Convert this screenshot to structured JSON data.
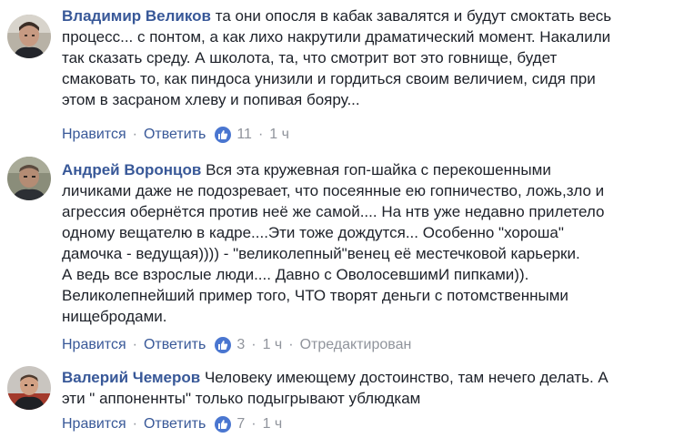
{
  "actions": {
    "like": "Нравится",
    "reply": "Ответить",
    "dot": "·"
  },
  "comments": [
    {
      "author": "Владимир Великов",
      "lines": [
        "та они опосля в кабак завалятся и будут смоктать весь",
        "процесс... с понтом, а как лихо накрутили драматический момент. Накалили",
        "так сказать среду. А школота, та, что смотрит вот это говнище, будет",
        "смаковать то, как пиндоса унизили и гордиться своим величием, сидя при",
        "этом в засраном хлеву и попивая бояру..."
      ],
      "likes": "11",
      "time": "1 ч",
      "edited": ""
    },
    {
      "author": "Андрей Воронцов",
      "lines": [
        "Вся эта кружевная гоп-шайка с перекошенными",
        "личиками даже не подозревает, что посеянные ею гопничество, ложь,зло и",
        "агрессия обернётся против неё же самой.... На нтв уже недавно прилетело",
        "одному вещателю в кадре....Эти тоже дождутся... Особенно \"хороша\"",
        "дамочка - ведущая)))) - \"великолепный\"венец её местечковой карьерки.",
        "А ведь все взрослые люди.... Давно с ОволосевшимИ пипками)).",
        "Великолепнейший пример того, ЧТО творят деньги с потомственными",
        "нищебродами."
      ],
      "likes": "3",
      "time": "1 ч",
      "edited": "Отредактирован"
    },
    {
      "author": "Валерий Чемеров",
      "lines": [
        "Человеку имеющему достоинство, там нечего делать. А",
        "эти \" аппоненнты\" только подыгрывают ублюдкам"
      ],
      "likes": "7",
      "time": "1 ч",
      "edited": ""
    }
  ],
  "colors": {
    "link": "#385898",
    "text": "#1d2129",
    "meta": "#90949c",
    "like_badge": "#4a76d0"
  },
  "icons": {
    "avatar": "profile-photo",
    "like": "thumbs-up-icon"
  }
}
